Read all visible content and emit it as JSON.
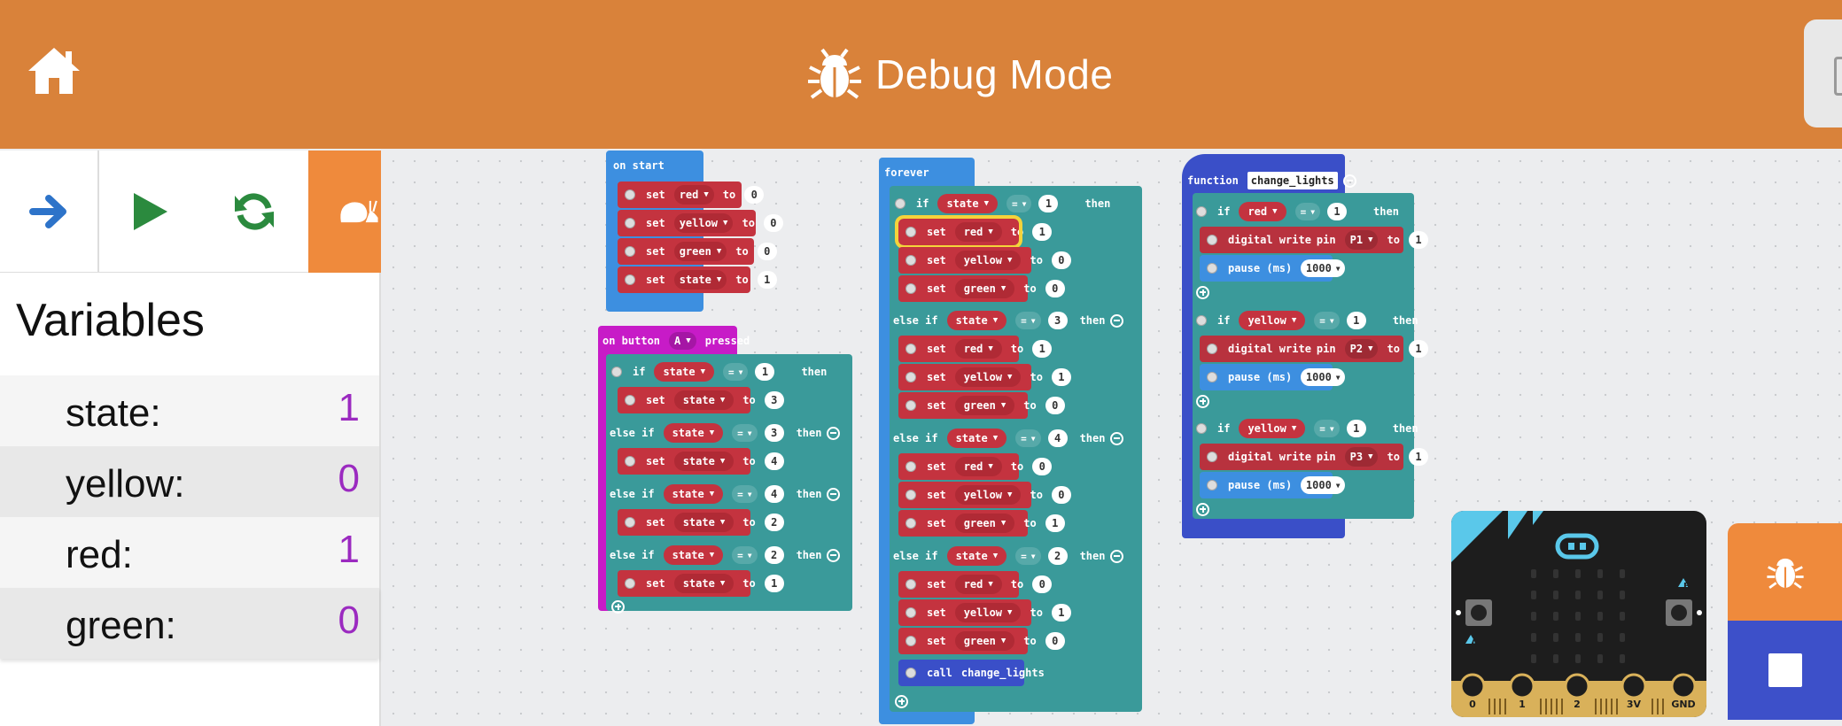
{
  "header": {
    "title": "Debug Mode",
    "color": "#d9823a"
  },
  "toolbar": {
    "icons": [
      "arrow-right-icon",
      "play-icon",
      "refresh-icon",
      "snail-icon"
    ]
  },
  "variables": {
    "title": "Variables",
    "items": [
      {
        "name": "state:",
        "value": "1"
      },
      {
        "name": "yellow:",
        "value": "0"
      },
      {
        "name": "red:",
        "value": "1"
      },
      {
        "name": "green:",
        "value": "0"
      }
    ]
  },
  "blocks": {
    "on_start": {
      "hat": "on start",
      "set": "set",
      "to": "to",
      "rows": [
        {
          "var": "red",
          "val": "0"
        },
        {
          "var": "yellow",
          "val": "0"
        },
        {
          "var": "green",
          "val": "0"
        },
        {
          "var": "state",
          "val": "1"
        }
      ]
    },
    "on_button": {
      "hat_prefix": "on button",
      "button": "A",
      "hat_suffix": "pressed",
      "if": "if",
      "else_if": "else if",
      "then": "then",
      "var": "state",
      "op": "=",
      "set": "set",
      "to": "to",
      "branches": [
        {
          "cond": "1",
          "set_val": "3"
        },
        {
          "cond": "3",
          "set_val": "4"
        },
        {
          "cond": "4",
          "set_val": "2"
        },
        {
          "cond": "2",
          "set_val": "1"
        }
      ]
    },
    "forever": {
      "hat": "forever",
      "if": "if",
      "else_if": "else if",
      "then": "then",
      "var": "state",
      "op": "=",
      "set": "set",
      "to": "to",
      "branches": [
        {
          "cond": "1",
          "red": "1",
          "yellow": "0",
          "green": "0"
        },
        {
          "cond": "3",
          "red": "1",
          "yellow": "1",
          "green": "0"
        },
        {
          "cond": "4",
          "red": "0",
          "yellow": "0",
          "green": "1"
        },
        {
          "cond": "2",
          "red": "0",
          "yellow": "1",
          "green": "0"
        }
      ],
      "var_names": {
        "red": "red",
        "yellow": "yellow",
        "green": "green"
      },
      "call": "call",
      "call_name": "change_lights"
    },
    "function": {
      "keyword": "function",
      "name": "change_lights",
      "if": "if",
      "then": "then",
      "op": "=",
      "write": "digital write",
      "pin": "pin",
      "to": "to",
      "pause": "pause (ms)",
      "branches": [
        {
          "var": "red",
          "cond": "1",
          "pin": "P1",
          "val": "1",
          "pause": "1000"
        },
        {
          "var": "yellow",
          "cond": "1",
          "pin": "P2",
          "val": "1",
          "pause": "1000"
        },
        {
          "var": "yellow",
          "cond": "1",
          "pin": "P3",
          "val": "1",
          "pause": "1000"
        }
      ]
    }
  },
  "simulator": {
    "pins": [
      "0",
      "1",
      "2",
      "3V",
      "GND"
    ],
    "button_a": "A",
    "button_b": "B"
  },
  "colors": {
    "logic": "#3a9a9a",
    "variables": "#c4333f",
    "events_start": "#3d8fe0",
    "input": "#c71bc7",
    "forever": "#3d8fe0",
    "functions": "#3a4fc8",
    "pins": "#b8323e",
    "highlight": "#f5d33a",
    "value_purple": "#9b2ac0"
  }
}
